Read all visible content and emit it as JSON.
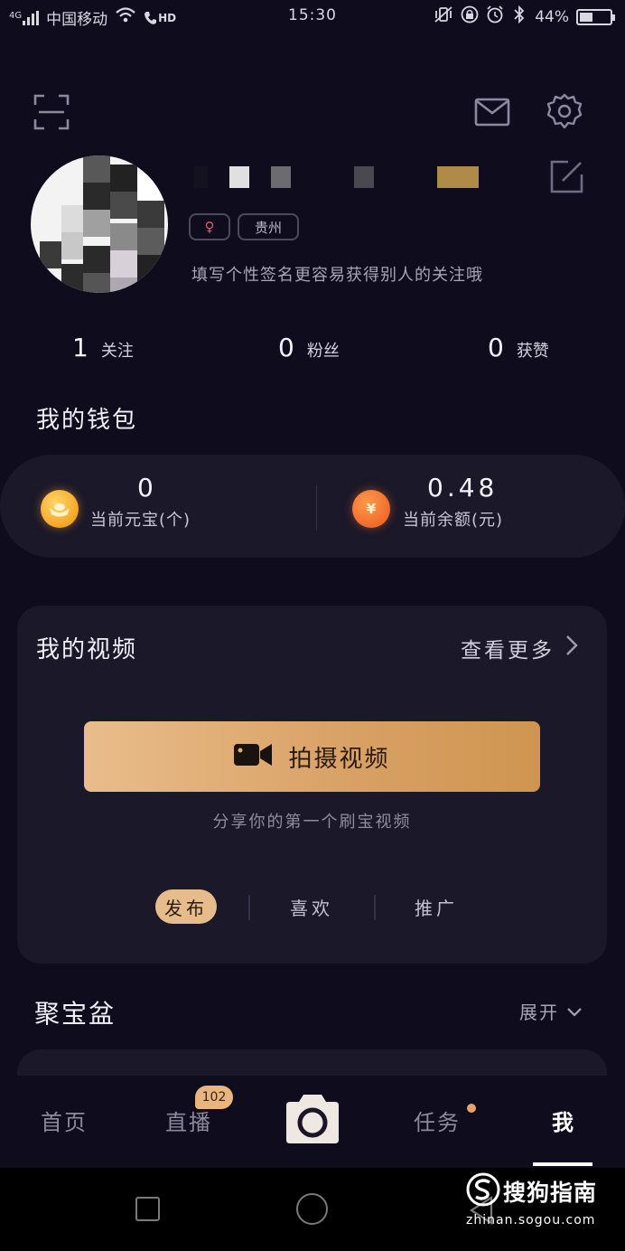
{
  "status_bar": {
    "network": "4G",
    "carrier": "中国移动",
    "hd": "HD",
    "time": "15:30",
    "battery": "44%",
    "battery_level": 0.44
  },
  "profile": {
    "tags": {
      "gender_symbol": "♀",
      "location": "贵州"
    },
    "signature": "填写个性签名更容易获得别人的关注哦"
  },
  "stats": [
    {
      "num": "1",
      "label": "关注"
    },
    {
      "num": "0",
      "label": "粉丝"
    },
    {
      "num": "0",
      "label": "获赞"
    }
  ],
  "wallet": {
    "title": "我的钱包",
    "yuanbao": {
      "value": "0",
      "label": "当前元宝(个)"
    },
    "balance": {
      "value": "0.48",
      "label": "当前余额(元)",
      "coin_symbol": "¥"
    }
  },
  "videos": {
    "title": "我的视频",
    "more": "查看更多",
    "shoot_button": "拍摄视频",
    "hint": "分享你的第一个刷宝视频",
    "tabs": [
      "发布",
      "喜欢",
      "推广"
    ]
  },
  "treasure": {
    "title": "聚宝盆",
    "expand": "展开"
  },
  "tabbar": {
    "home": "首页",
    "live": "直播",
    "live_badge": "102",
    "tasks": "任务",
    "me": "我"
  },
  "watermark": {
    "brand": "搜狗指南",
    "url": "zhinan.sogou.com"
  },
  "colors": {
    "background": "#0f0c1e",
    "card": "#1b1829",
    "accent_gold": "#e6bc8a",
    "coin_gold": "#f5a524",
    "coin_orange": "#f06b2a"
  }
}
